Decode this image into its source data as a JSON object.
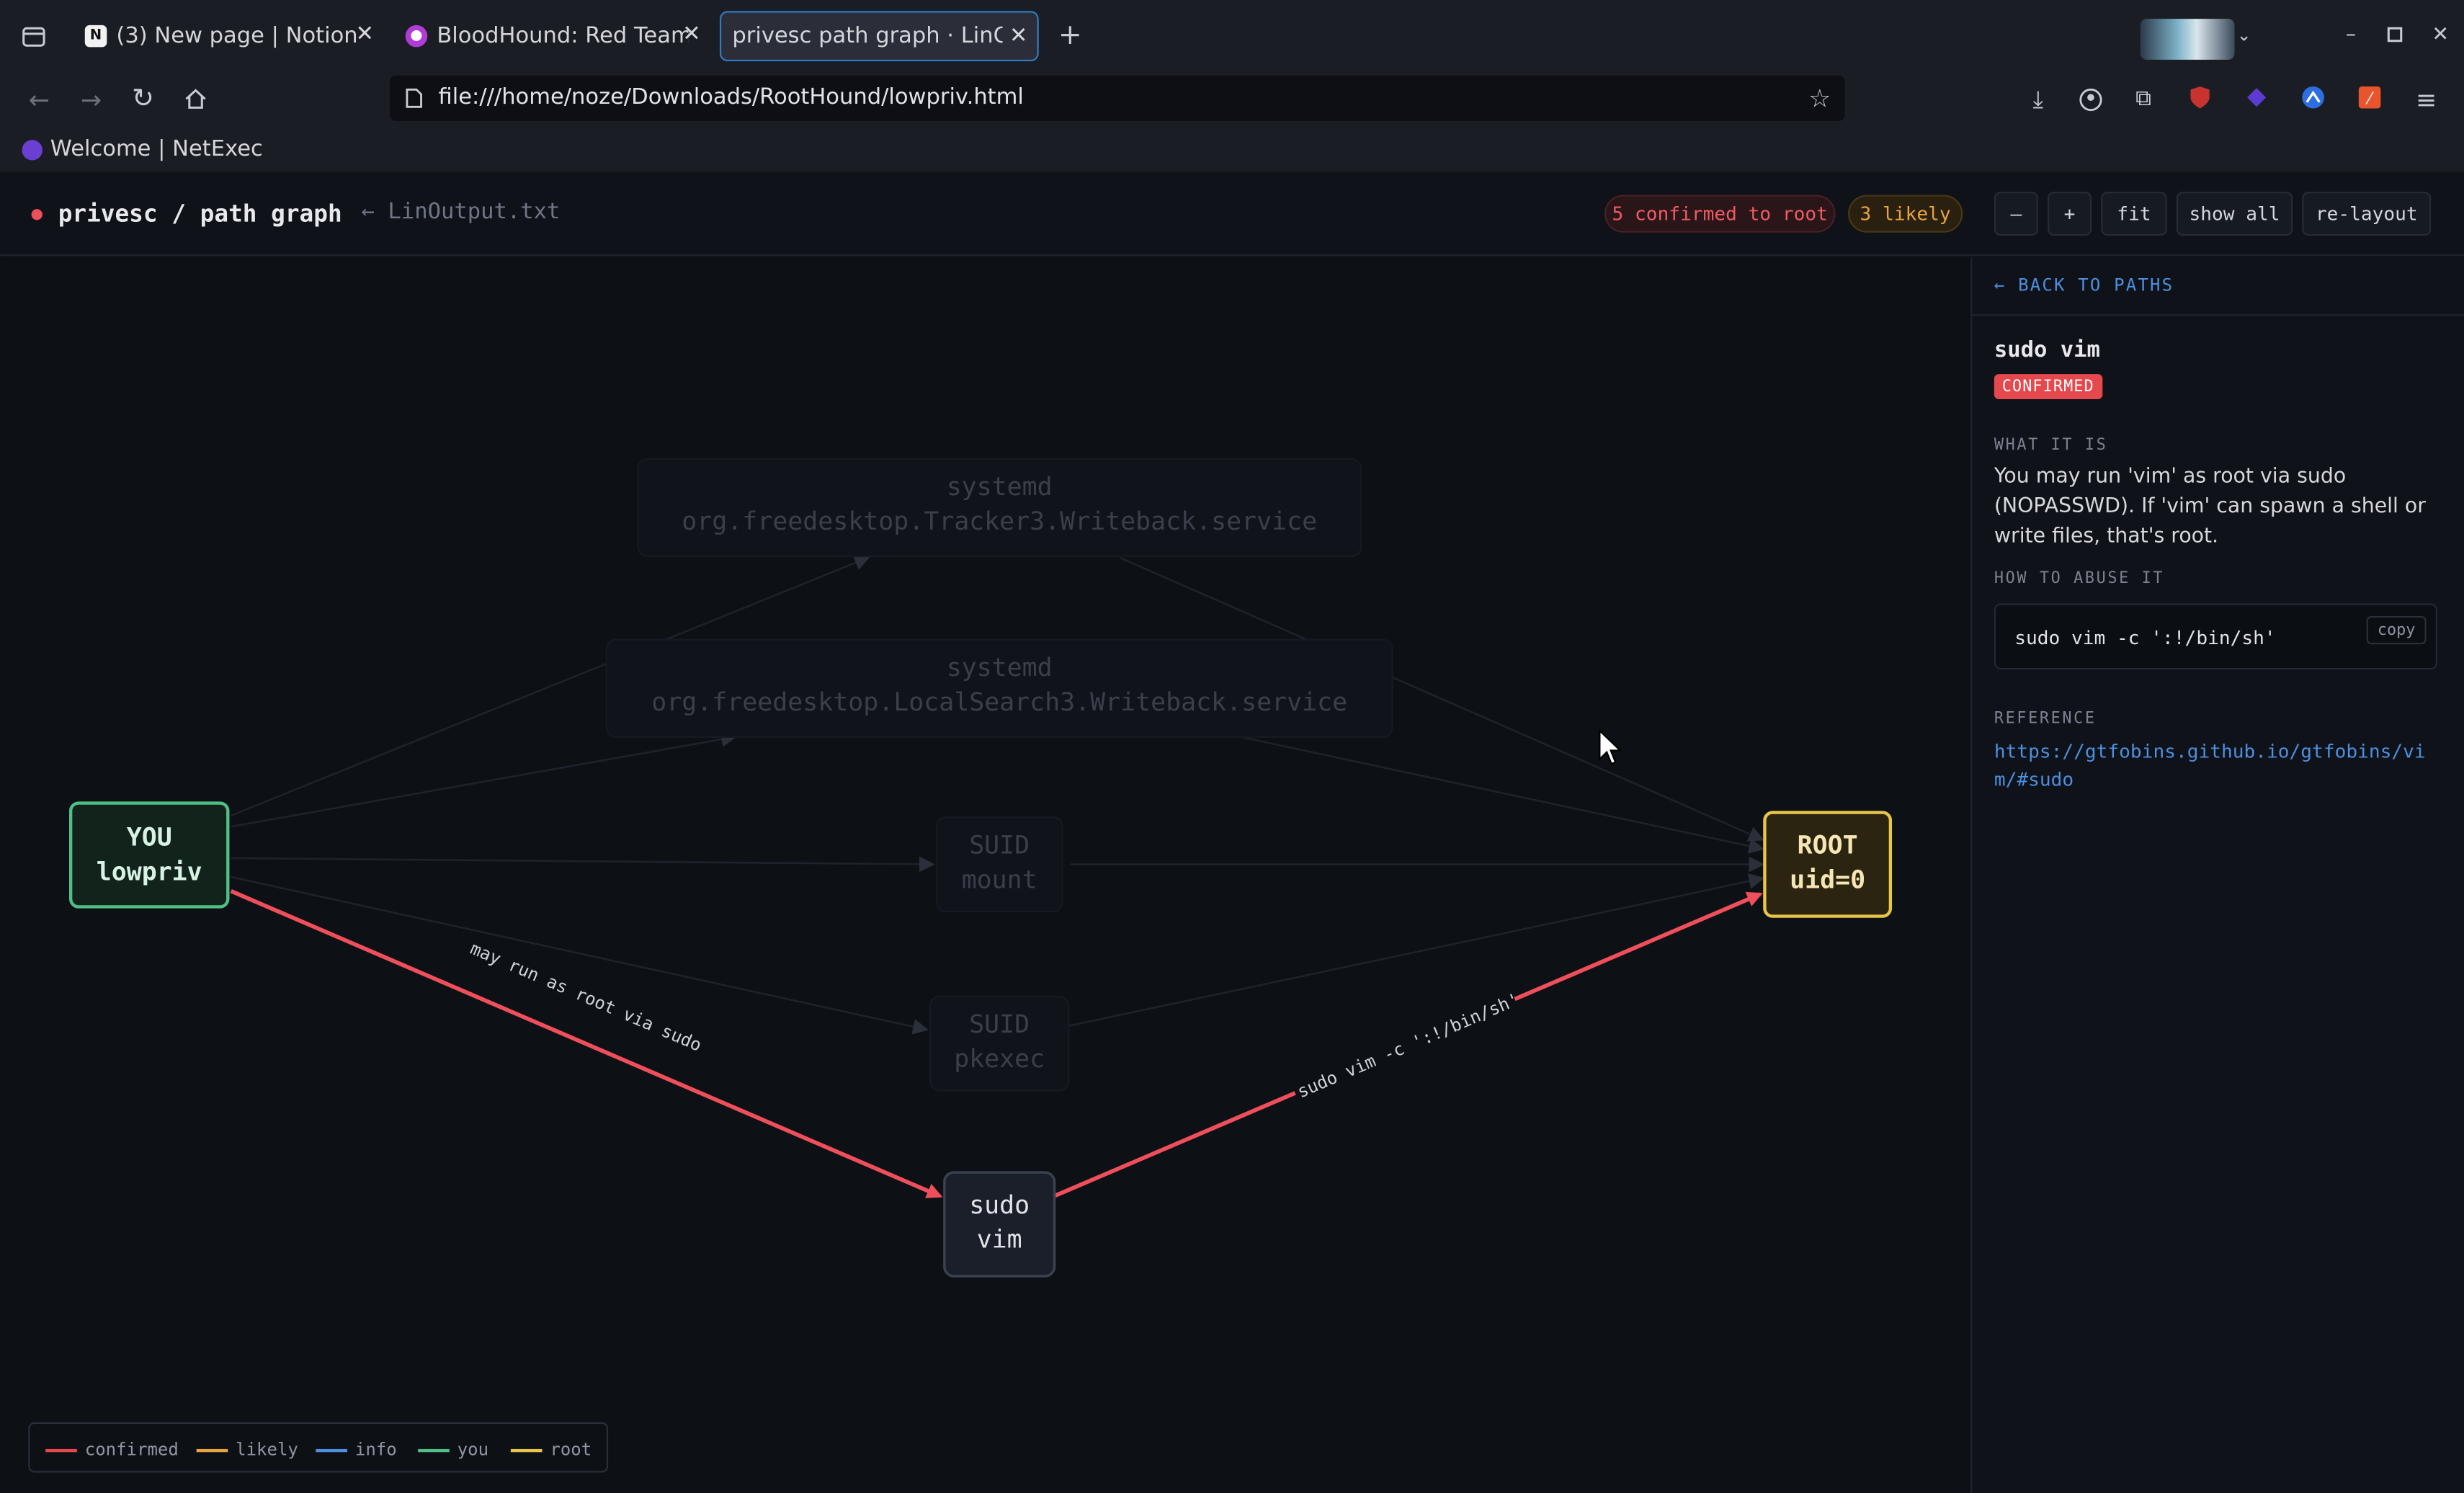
{
  "browser": {
    "tabs": [
      {
        "title": "(3) New page | Notion"
      },
      {
        "title": "BloodHound: Red Team T"
      },
      {
        "title": "privesc path graph · LinOutpu"
      }
    ],
    "url": "file:///home/noze/Downloads/RootHound/lowpriv.html",
    "bookmark": "Welcome | NetExec"
  },
  "header": {
    "title": "privesc / path graph",
    "source": "← LinOutput.txt",
    "confirmed_pill": "5 confirmed to root",
    "likely_pill": "3 likely",
    "buttons": {
      "zoom_out": "–",
      "zoom_in": "+",
      "fit": "fit",
      "show_all": "show all",
      "relayout": "re-layout"
    }
  },
  "graph": {
    "nodes": {
      "you": {
        "line1": "YOU",
        "line2": "lowpriv"
      },
      "root": {
        "line1": "ROOT",
        "line2": "uid=0"
      },
      "tracker": {
        "line1": "systemd",
        "line2": "org.freedesktop.Tracker3.Writeback.service"
      },
      "localsearch": {
        "line1": "systemd",
        "line2": "org.freedesktop.LocalSearch3.Writeback.service"
      },
      "mount": {
        "line1": "SUID",
        "line2": "mount"
      },
      "pkexec": {
        "line1": "SUID",
        "line2": "pkexec"
      },
      "sudovim": {
        "line1": "sudo",
        "line2": "vim"
      }
    },
    "edges": {
      "you_to_vim": "may run as root via sudo",
      "vim_to_root": "sudo vim -c ':!/bin/sh'"
    },
    "legend": [
      {
        "label": "confirmed",
        "color": "#e5484d"
      },
      {
        "label": "likely",
        "color": "#e7a33e"
      },
      {
        "label": "info",
        "color": "#4d8fe0"
      },
      {
        "label": "you",
        "color": "#4fbf85"
      },
      {
        "label": "root",
        "color": "#e8c54a"
      }
    ]
  },
  "panel": {
    "back": "← BACK TO PATHS",
    "title": "sudo vim",
    "badge": "CONFIRMED",
    "what_label": "WHAT IT IS",
    "what_text": "You may run 'vim' as root via sudo (NOPASSWD). If 'vim' can spawn a shell or write files, that's root.",
    "how_label": "HOW TO ABUSE IT",
    "command": "sudo vim -c ':!/bin/sh'",
    "copy": "copy",
    "ref_label": "REFERENCE",
    "ref_url": "https://gtfobins.github.io/gtfobins/vim/#sudo"
  }
}
